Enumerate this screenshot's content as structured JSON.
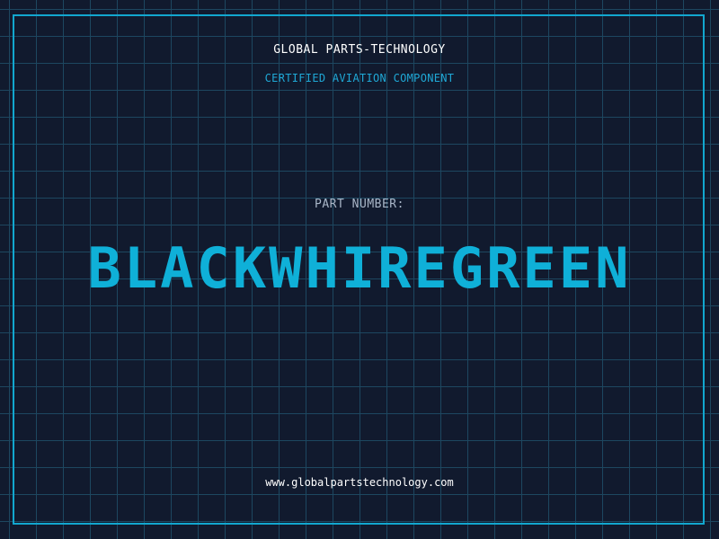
{
  "header": {
    "company": "GLOBAL PARTS-TECHNOLOGY",
    "tagline": "CERTIFIED AVIATION COMPONENT"
  },
  "part": {
    "label": "PART NUMBER:",
    "number": "BLACKWHIREGREEN"
  },
  "footer": {
    "website": "www.globalpartstechnology.com"
  },
  "colors": {
    "background": "#111a2e",
    "grid": "#1d4760",
    "accent": "#0fb0d8",
    "label": "#a9b6c8",
    "text": "#ffffff"
  }
}
